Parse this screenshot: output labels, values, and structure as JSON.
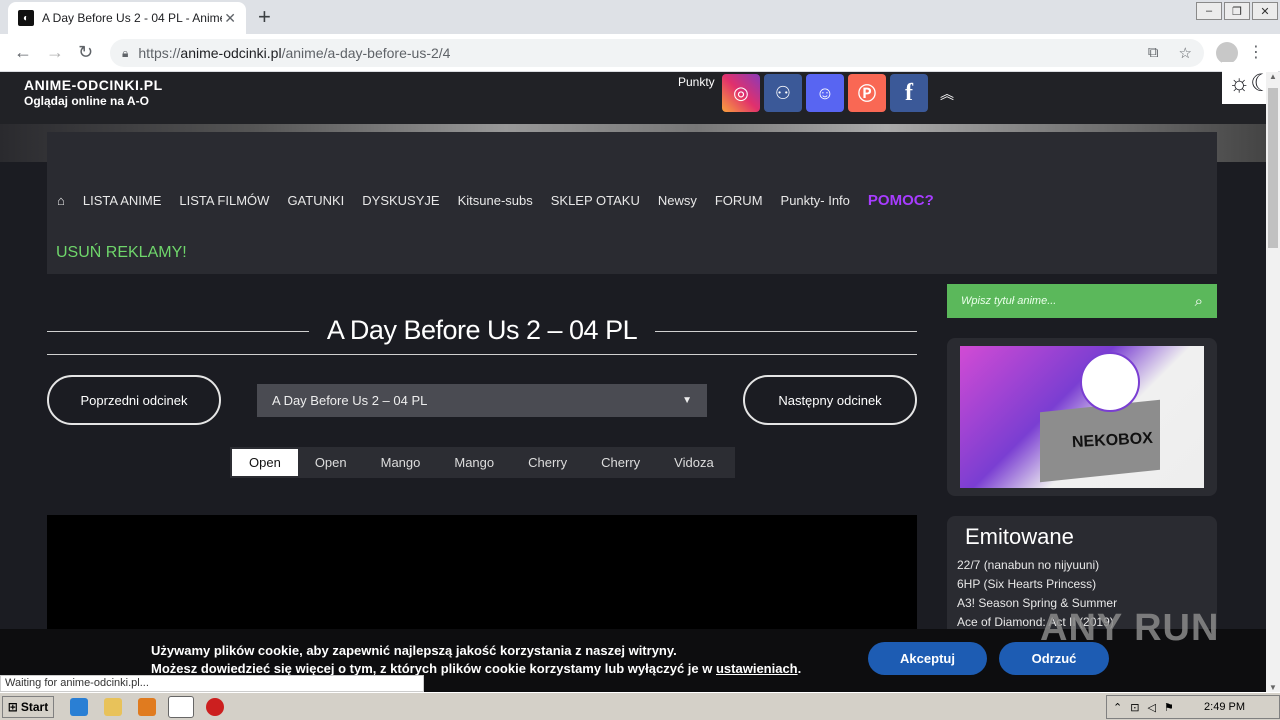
{
  "browser": {
    "tab_title": "A Day Before Us 2 - 04 PL - Anime-O",
    "url_scheme": "https://",
    "url_host": "anime-odcinki.pl",
    "url_path": "/anime/a-day-before-us-2/4",
    "status_text": "Waiting for anime-odcinki.pl..."
  },
  "site": {
    "name": "ANIME-ODCINKI.PL",
    "tagline": "Oglądaj online na A-O",
    "points_label": "Punkty"
  },
  "nav": {
    "items": [
      "LISTA ANIME",
      "LISTA FILMÓW",
      "GATUNKI",
      "DYSKUSYJE",
      "Kitsune-subs",
      "SKLEP OTAKU",
      "Newsy",
      "FORUM",
      "Punkty- Info"
    ],
    "help": "POMOC?",
    "remove_ads": "USUŃ REKLAMY!"
  },
  "episode": {
    "title": "A Day Before Us 2 – 04 PL",
    "prev_label": "Poprzedni odcinek",
    "next_label": "Następny odcinek",
    "selected": "A Day Before Us 2 – 04 PL"
  },
  "players": [
    "Open",
    "Open",
    "Mango",
    "Mango",
    "Cherry",
    "Cherry",
    "Vidoza"
  ],
  "sidebar": {
    "search_placeholder": "Wpisz tytuł anime...",
    "promo_label": "NEKOBOX",
    "aired_title": "Emitowane",
    "aired_list": [
      "22/7 (nanabun no nijyuuni)",
      "6HP (Six Hearts Princess)",
      "A3! Season Spring & Summer",
      "Ace of Diamond: Act II (2019)"
    ]
  },
  "cookie": {
    "line1": "Używamy plików cookie, aby zapewnić najlepszą jakość korzystania z naszej witryny.",
    "line2_prefix": "Możesz dowiedzieć się więcej o tym, z których plików cookie korzystamy lub wyłączyć je w ",
    "line2_link": "ustawieniach",
    "accept": "Akceptuj",
    "reject": "Odrzuć"
  },
  "taskbar": {
    "start": "Start",
    "clock": "2:49 PM"
  },
  "watermark": "ANY RUN",
  "colors": {
    "page_bg": "#1b1c22",
    "accent_green": "#5bb85b",
    "help_purple": "#a73cff",
    "button_blue": "#1d5cb3"
  }
}
